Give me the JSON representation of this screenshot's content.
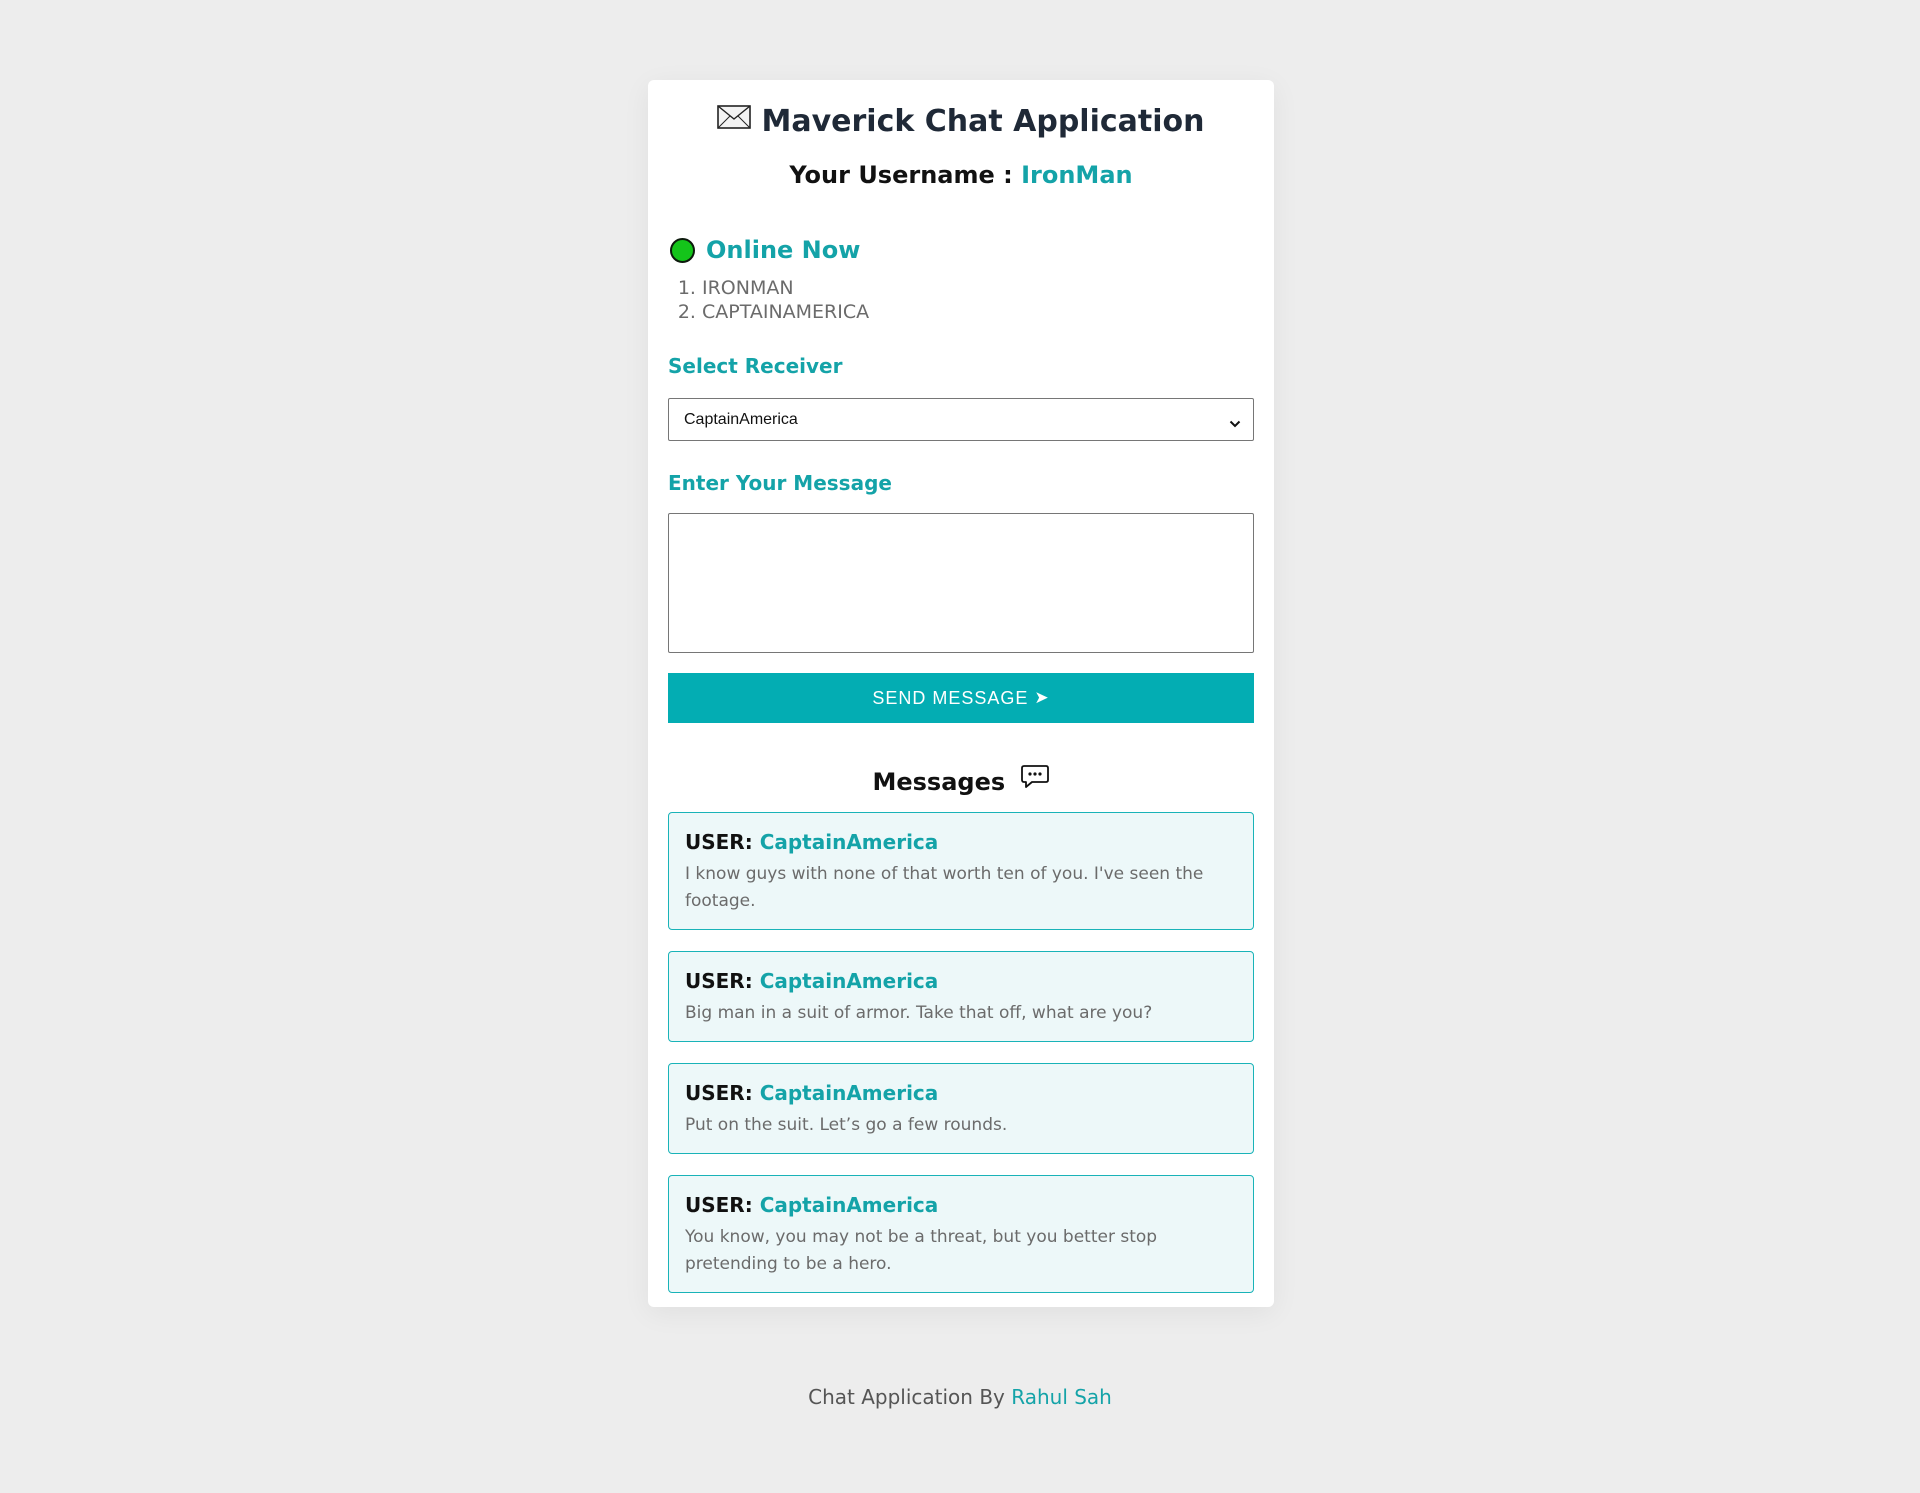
{
  "header": {
    "title": "Maverick Chat Application",
    "username_label": "Your Username :",
    "username": "IronMan"
  },
  "online": {
    "title": "Online Now",
    "users": [
      "IRONMAN",
      "CAPTAINAMERICA"
    ]
  },
  "form": {
    "receiver_label": "Select Receiver",
    "receiver_selected": "CaptainAmerica",
    "message_label": "Enter Your Message",
    "message_value": "",
    "send_label": "SEND MESSAGE",
    "send_icon": "➤"
  },
  "messages": {
    "title": "Messages",
    "user_prefix": "USER:",
    "items": [
      {
        "user": "CaptainAmerica",
        "text": "I know guys with none of that worth ten of you. I've seen the footage."
      },
      {
        "user": "CaptainAmerica",
        "text": "Big man in a suit of armor. Take that off, what are you?"
      },
      {
        "user": "CaptainAmerica",
        "text": "Put on the suit. Let’s go a few rounds."
      },
      {
        "user": "CaptainAmerica",
        "text": "You know, you may not be a threat, but you better stop pretending to be a hero."
      }
    ]
  },
  "footer": {
    "text": "Chat Application By",
    "author": "Rahul Sah"
  },
  "colors": {
    "accent": "#03adb3",
    "online_dot": "#14c41a",
    "background": "#ededed"
  }
}
